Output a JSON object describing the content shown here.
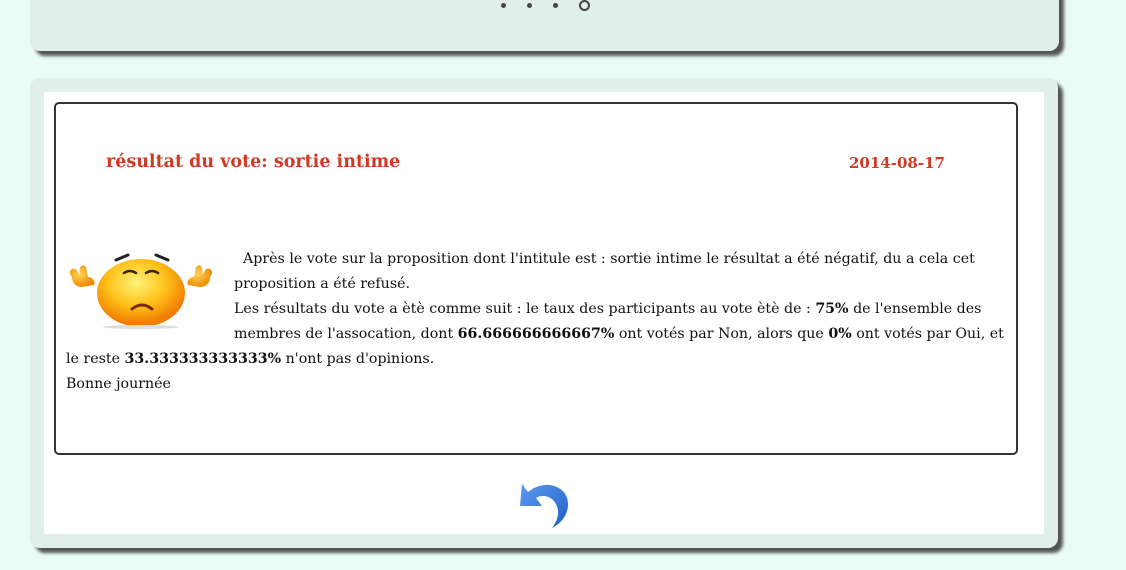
{
  "carousel": {
    "dot_count": 4,
    "active_index": 3
  },
  "message": {
    "title": "résultat du vote: sortie intime",
    "date": "2014-08-17",
    "intro": "Après le vote sur la proposition dont l'intitule est : sortie intime le résultat a été négatif, du a cela cet proposition a été refusé.",
    "results_prefix": "Les résultats du vote a ètè comme suit : le taux des participants au vote ètè de :",
    "participation_rate": "75%",
    "results_mid1": "de l'ensemble des membres de l'assocation, dont",
    "no_pct": "66.666666666667%",
    "results_mid2": "ont votés par Non, alors que",
    "yes_pct": "0%",
    "results_mid3": "ont votés par Oui, et le reste",
    "abstain_pct": "33.333333333333%",
    "results_end": "n'ont pas d'opinions.",
    "closing": "Bonne journée"
  },
  "icons": {
    "emoticon": "worried-smiley-icon",
    "back": "undo-arrow-icon"
  },
  "colors": {
    "title": "#d03a24",
    "back_arrow": "#2f74d4",
    "page_bg": "#eafcf6",
    "panel_bg": "#e1efeb"
  }
}
